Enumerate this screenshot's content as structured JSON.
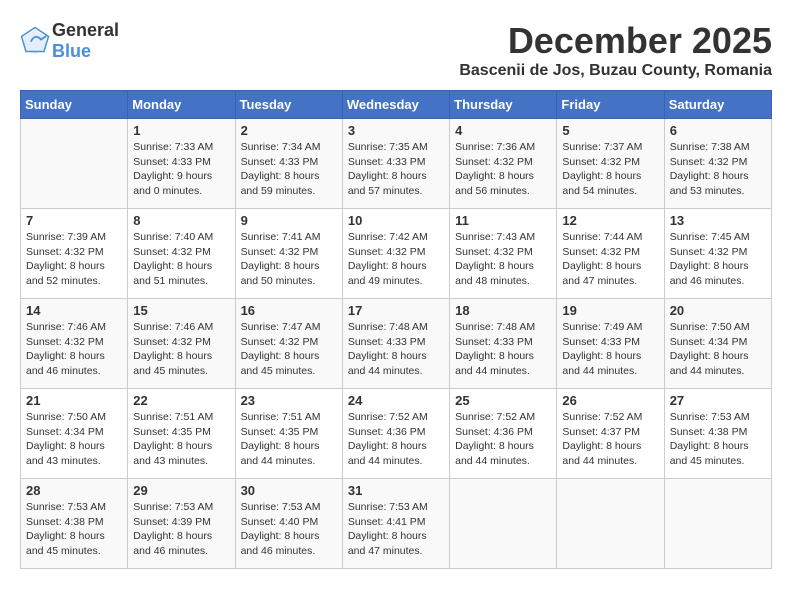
{
  "header": {
    "logo_general": "General",
    "logo_blue": "Blue",
    "title": "December 2025",
    "subtitle": "Bascenii de Jos, Buzau County, Romania"
  },
  "weekdays": [
    "Sunday",
    "Monday",
    "Tuesday",
    "Wednesday",
    "Thursday",
    "Friday",
    "Saturday"
  ],
  "weeks": [
    [
      {
        "day": "",
        "sunrise": "",
        "sunset": "",
        "daylight": ""
      },
      {
        "day": "1",
        "sunrise": "Sunrise: 7:33 AM",
        "sunset": "Sunset: 4:33 PM",
        "daylight": "Daylight: 9 hours and 0 minutes."
      },
      {
        "day": "2",
        "sunrise": "Sunrise: 7:34 AM",
        "sunset": "Sunset: 4:33 PM",
        "daylight": "Daylight: 8 hours and 59 minutes."
      },
      {
        "day": "3",
        "sunrise": "Sunrise: 7:35 AM",
        "sunset": "Sunset: 4:33 PM",
        "daylight": "Daylight: 8 hours and 57 minutes."
      },
      {
        "day": "4",
        "sunrise": "Sunrise: 7:36 AM",
        "sunset": "Sunset: 4:32 PM",
        "daylight": "Daylight: 8 hours and 56 minutes."
      },
      {
        "day": "5",
        "sunrise": "Sunrise: 7:37 AM",
        "sunset": "Sunset: 4:32 PM",
        "daylight": "Daylight: 8 hours and 54 minutes."
      },
      {
        "day": "6",
        "sunrise": "Sunrise: 7:38 AM",
        "sunset": "Sunset: 4:32 PM",
        "daylight": "Daylight: 8 hours and 53 minutes."
      }
    ],
    [
      {
        "day": "7",
        "sunrise": "Sunrise: 7:39 AM",
        "sunset": "Sunset: 4:32 PM",
        "daylight": "Daylight: 8 hours and 52 minutes."
      },
      {
        "day": "8",
        "sunrise": "Sunrise: 7:40 AM",
        "sunset": "Sunset: 4:32 PM",
        "daylight": "Daylight: 8 hours and 51 minutes."
      },
      {
        "day": "9",
        "sunrise": "Sunrise: 7:41 AM",
        "sunset": "Sunset: 4:32 PM",
        "daylight": "Daylight: 8 hours and 50 minutes."
      },
      {
        "day": "10",
        "sunrise": "Sunrise: 7:42 AM",
        "sunset": "Sunset: 4:32 PM",
        "daylight": "Daylight: 8 hours and 49 minutes."
      },
      {
        "day": "11",
        "sunrise": "Sunrise: 7:43 AM",
        "sunset": "Sunset: 4:32 PM",
        "daylight": "Daylight: 8 hours and 48 minutes."
      },
      {
        "day": "12",
        "sunrise": "Sunrise: 7:44 AM",
        "sunset": "Sunset: 4:32 PM",
        "daylight": "Daylight: 8 hours and 47 minutes."
      },
      {
        "day": "13",
        "sunrise": "Sunrise: 7:45 AM",
        "sunset": "Sunset: 4:32 PM",
        "daylight": "Daylight: 8 hours and 46 minutes."
      }
    ],
    [
      {
        "day": "14",
        "sunrise": "Sunrise: 7:46 AM",
        "sunset": "Sunset: 4:32 PM",
        "daylight": "Daylight: 8 hours and 46 minutes."
      },
      {
        "day": "15",
        "sunrise": "Sunrise: 7:46 AM",
        "sunset": "Sunset: 4:32 PM",
        "daylight": "Daylight: 8 hours and 45 minutes."
      },
      {
        "day": "16",
        "sunrise": "Sunrise: 7:47 AM",
        "sunset": "Sunset: 4:32 PM",
        "daylight": "Daylight: 8 hours and 45 minutes."
      },
      {
        "day": "17",
        "sunrise": "Sunrise: 7:48 AM",
        "sunset": "Sunset: 4:33 PM",
        "daylight": "Daylight: 8 hours and 44 minutes."
      },
      {
        "day": "18",
        "sunrise": "Sunrise: 7:48 AM",
        "sunset": "Sunset: 4:33 PM",
        "daylight": "Daylight: 8 hours and 44 minutes."
      },
      {
        "day": "19",
        "sunrise": "Sunrise: 7:49 AM",
        "sunset": "Sunset: 4:33 PM",
        "daylight": "Daylight: 8 hours and 44 minutes."
      },
      {
        "day": "20",
        "sunrise": "Sunrise: 7:50 AM",
        "sunset": "Sunset: 4:34 PM",
        "daylight": "Daylight: 8 hours and 44 minutes."
      }
    ],
    [
      {
        "day": "21",
        "sunrise": "Sunrise: 7:50 AM",
        "sunset": "Sunset: 4:34 PM",
        "daylight": "Daylight: 8 hours and 43 minutes."
      },
      {
        "day": "22",
        "sunrise": "Sunrise: 7:51 AM",
        "sunset": "Sunset: 4:35 PM",
        "daylight": "Daylight: 8 hours and 43 minutes."
      },
      {
        "day": "23",
        "sunrise": "Sunrise: 7:51 AM",
        "sunset": "Sunset: 4:35 PM",
        "daylight": "Daylight: 8 hours and 44 minutes."
      },
      {
        "day": "24",
        "sunrise": "Sunrise: 7:52 AM",
        "sunset": "Sunset: 4:36 PM",
        "daylight": "Daylight: 8 hours and 44 minutes."
      },
      {
        "day": "25",
        "sunrise": "Sunrise: 7:52 AM",
        "sunset": "Sunset: 4:36 PM",
        "daylight": "Daylight: 8 hours and 44 minutes."
      },
      {
        "day": "26",
        "sunrise": "Sunrise: 7:52 AM",
        "sunset": "Sunset: 4:37 PM",
        "daylight": "Daylight: 8 hours and 44 minutes."
      },
      {
        "day": "27",
        "sunrise": "Sunrise: 7:53 AM",
        "sunset": "Sunset: 4:38 PM",
        "daylight": "Daylight: 8 hours and 45 minutes."
      }
    ],
    [
      {
        "day": "28",
        "sunrise": "Sunrise: 7:53 AM",
        "sunset": "Sunset: 4:38 PM",
        "daylight": "Daylight: 8 hours and 45 minutes."
      },
      {
        "day": "29",
        "sunrise": "Sunrise: 7:53 AM",
        "sunset": "Sunset: 4:39 PM",
        "daylight": "Daylight: 8 hours and 46 minutes."
      },
      {
        "day": "30",
        "sunrise": "Sunrise: 7:53 AM",
        "sunset": "Sunset: 4:40 PM",
        "daylight": "Daylight: 8 hours and 46 minutes."
      },
      {
        "day": "31",
        "sunrise": "Sunrise: 7:53 AM",
        "sunset": "Sunset: 4:41 PM",
        "daylight": "Daylight: 8 hours and 47 minutes."
      },
      {
        "day": "",
        "sunrise": "",
        "sunset": "",
        "daylight": ""
      },
      {
        "day": "",
        "sunrise": "",
        "sunset": "",
        "daylight": ""
      },
      {
        "day": "",
        "sunrise": "",
        "sunset": "",
        "daylight": ""
      }
    ]
  ]
}
